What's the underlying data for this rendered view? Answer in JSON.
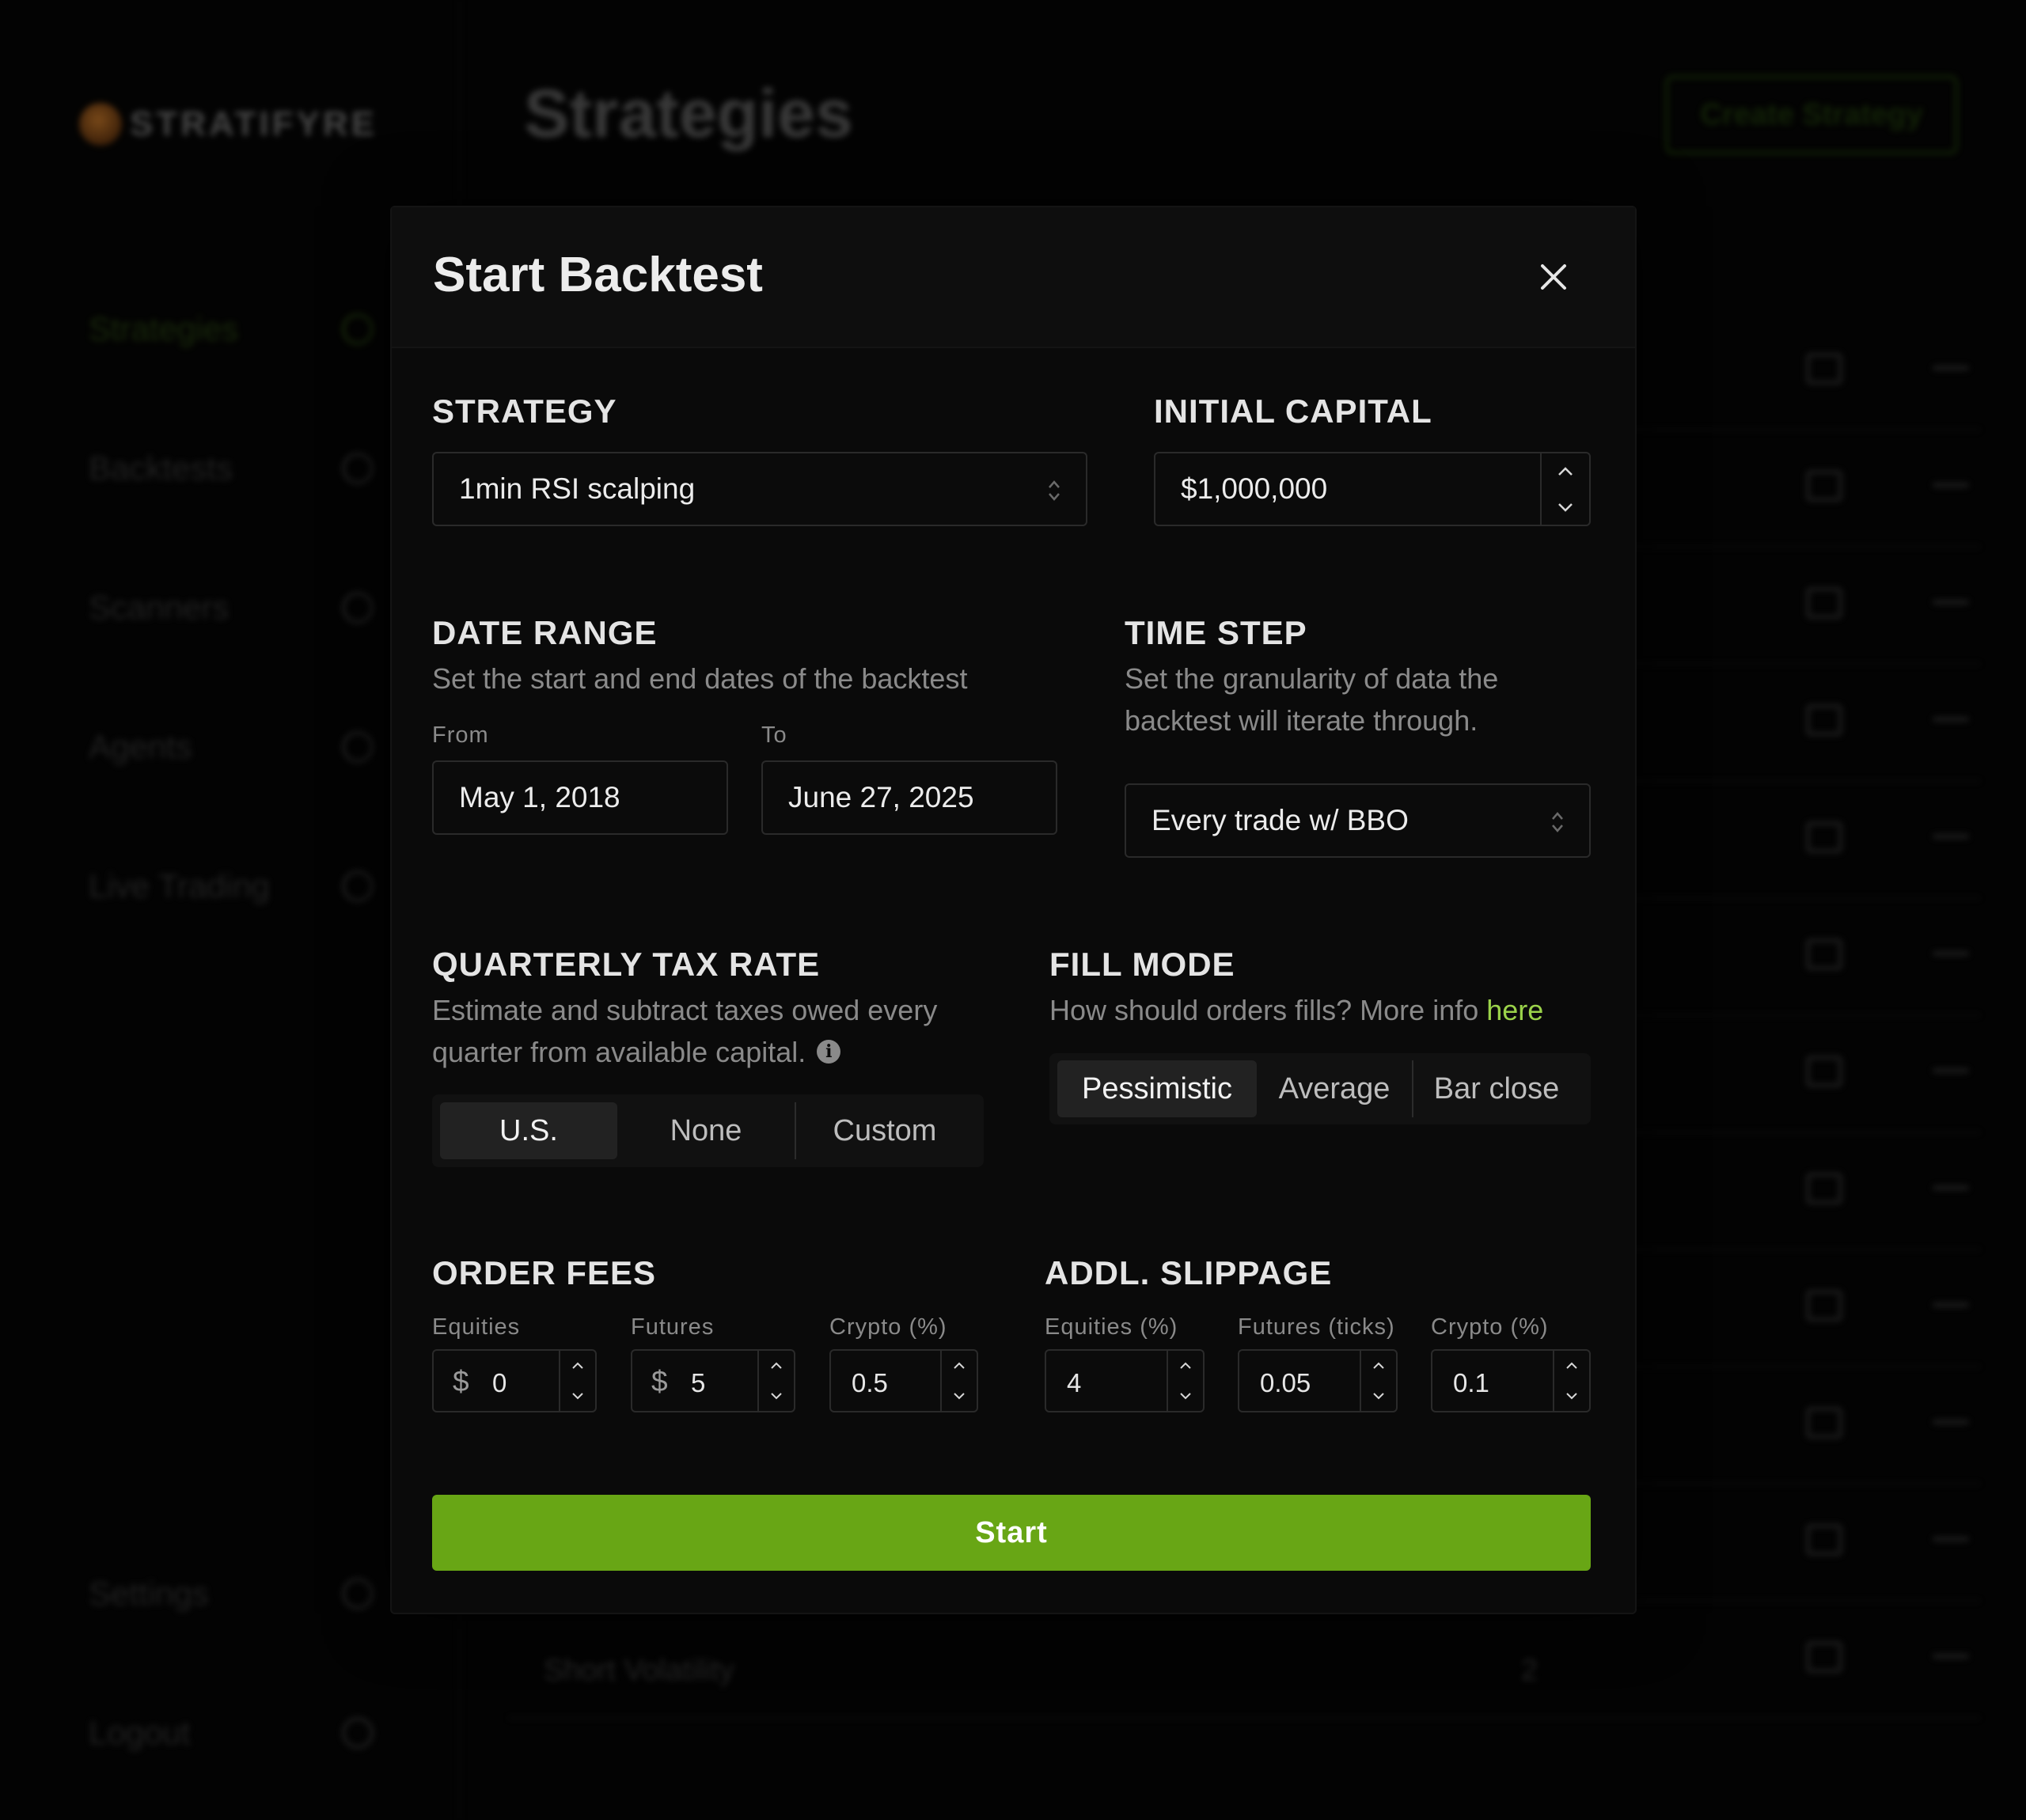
{
  "background": {
    "logo_text": "STRATIFYRE",
    "page_title": "Strategies",
    "create_button": "Create Strategy",
    "nav": [
      {
        "label": "Strategies",
        "icon": "strategies-icon",
        "active": true
      },
      {
        "label": "Backtests",
        "icon": "backtests-icon"
      },
      {
        "label": "Scanners",
        "icon": "scanners-icon"
      },
      {
        "label": "Agents",
        "icon": "agents-icon"
      },
      {
        "label": "Live Trading",
        "icon": "live-trading-icon"
      }
    ],
    "nav_bottom": [
      {
        "label": "Settings",
        "icon": "settings-icon"
      },
      {
        "label": "Logout",
        "icon": "logout-icon"
      }
    ],
    "last_row": {
      "name": "Short Volatility",
      "count": "2"
    }
  },
  "modal": {
    "title": "Start Backtest",
    "strategy": {
      "label": "STRATEGY",
      "value": "1min RSI scalping"
    },
    "initial_capital": {
      "label": "INITIAL CAPITAL",
      "value": "$1,000,000"
    },
    "date_range": {
      "label": "DATE RANGE",
      "description": "Set the start and end dates of the backtest",
      "from_label": "From",
      "from_value": "May 1, 2018",
      "to_label": "To",
      "to_value": "June 27, 2025"
    },
    "time_step": {
      "label": "TIME STEP",
      "description_line1": "Set the granularity of data the",
      "description_line2": "backtest will iterate through.",
      "value": "Every trade w/ BBO"
    },
    "tax_rate": {
      "label": "QUARTERLY TAX RATE",
      "description_line1": "Estimate and subtract taxes owed every",
      "description_line2": "quarter from available capital.",
      "options": [
        "U.S.",
        "None",
        "Custom"
      ],
      "selected": "U.S."
    },
    "fill_mode": {
      "label": "FILL MODE",
      "description": "How should orders fills? More info",
      "link_text": "here",
      "options": [
        "Pessimistic",
        "Average",
        "Bar close"
      ],
      "selected": "Pessimistic"
    },
    "order_fees": {
      "label": "ORDER FEES",
      "equities": {
        "label": "Equities",
        "currency": "$",
        "value": "0"
      },
      "futures": {
        "label": "Futures",
        "currency": "$",
        "value": "5"
      },
      "crypto": {
        "label": "Crypto (%)",
        "value": "0.5"
      }
    },
    "slippage": {
      "label": "ADDL. SLIPPAGE",
      "equities": {
        "label": "Equities (%)",
        "value": "4"
      },
      "futures": {
        "label": "Futures (ticks)",
        "value": "0.05"
      },
      "crypto": {
        "label": "Crypto (%)",
        "value": "0.1"
      }
    },
    "start_button": "Start"
  },
  "colors": {
    "accent": "#68a615",
    "link": "#9bd34a",
    "modal_bg": "#0a0a0a"
  }
}
